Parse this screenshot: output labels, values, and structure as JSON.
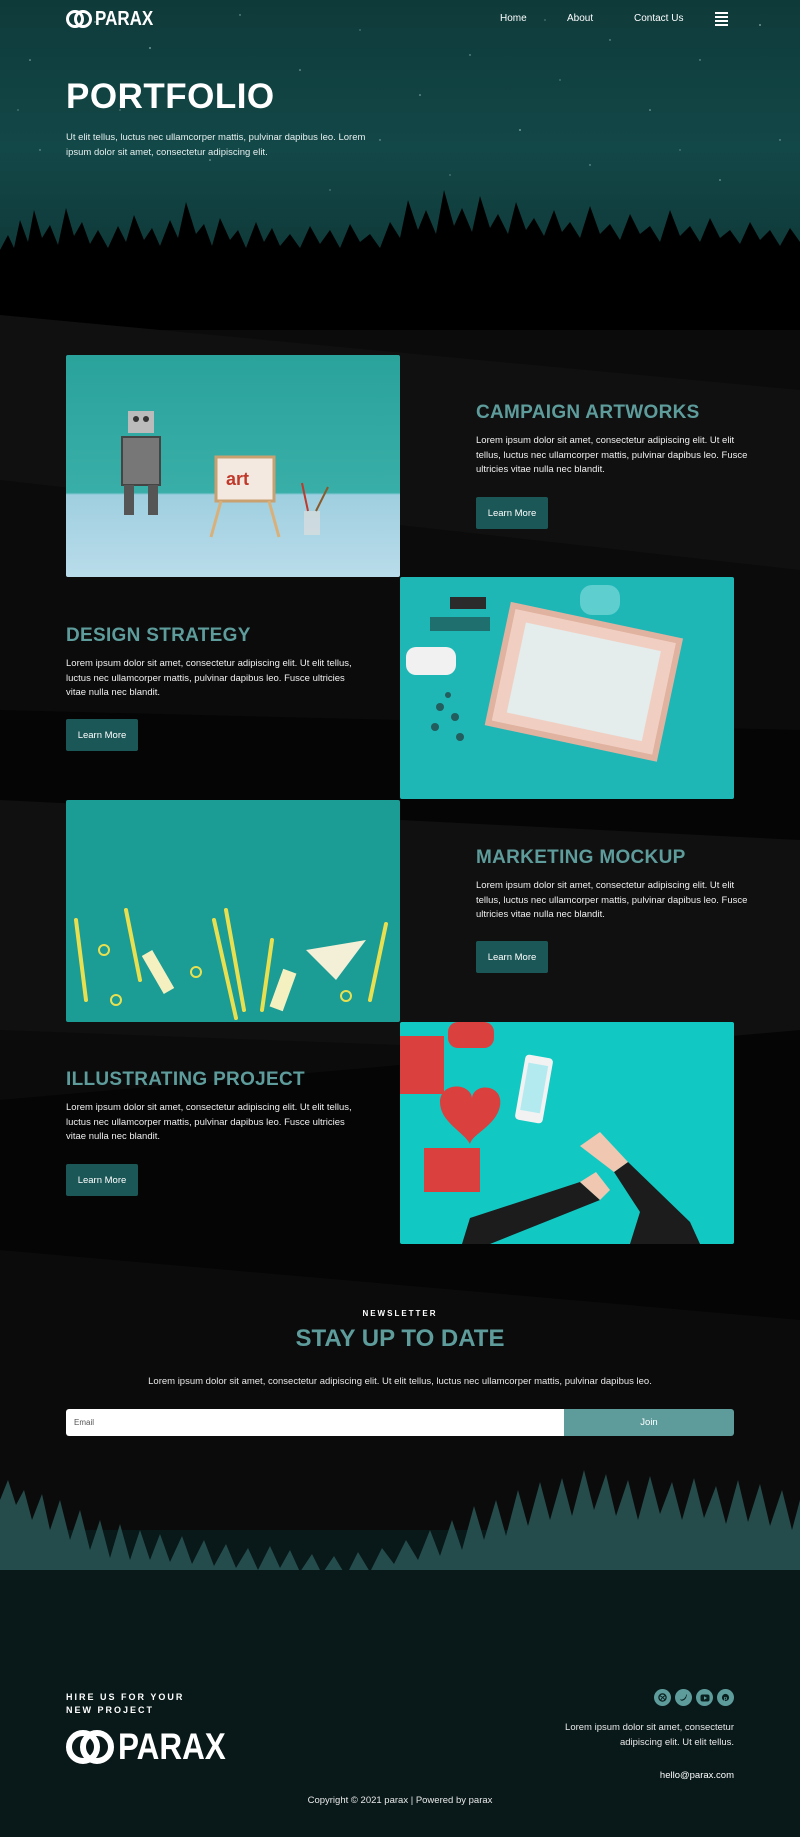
{
  "brand": {
    "name": "PARAX"
  },
  "nav": {
    "links": [
      "Home",
      "About",
      "Contact Us"
    ],
    "menu_icon": "hamburger-icon"
  },
  "hero": {
    "title": "PORTFOLIO",
    "subtitle": "Ut elit tellus, luctus nec ullamcorper mattis, pulvinar dapibus leo. Lorem ipsum dolor sit amet, consectetur adipiscing elit."
  },
  "portfolio": [
    {
      "title": "CAMPAIGN ARTWORKS",
      "text": "Lorem ipsum dolor sit amet, consectetur adipiscing elit. Ut elit tellus, luctus nec ullamcorper mattis, pulvinar dapibus leo. Fusce ultricies vitae nulla nec blandit.",
      "button": "Learn More"
    },
    {
      "title": "DESIGN STRATEGY",
      "text": "Lorem ipsum dolor sit amet, consectetur adipiscing elit. Ut elit tellus, luctus nec ullamcorper mattis, pulvinar dapibus leo. Fusce ultricies vitae nulla nec blandit.",
      "button": "Learn More"
    },
    {
      "title": "MARKETING MOCKUP",
      "text": "Lorem ipsum dolor sit amet, consectetur adipiscing elit. Ut elit tellus, luctus nec ullamcorper mattis, pulvinar dapibus leo. Fusce ultricies vitae nulla nec blandit.",
      "button": "Learn More"
    },
    {
      "title": "ILLUSTRATING PROJECT",
      "text": "Lorem ipsum dolor sit amet, consectetur adipiscing elit. Ut elit tellus, luctus nec ullamcorper mattis, pulvinar dapibus leo. Fusce ultricies vitae nulla nec blandit.",
      "button": "Learn More"
    }
  ],
  "newsletter": {
    "kicker": "NEWSLETTER",
    "title": "STAY UP TO DATE",
    "description": "Lorem ipsum dolor sit amet, consectetur adipiscing elit. Ut elit tellus, luctus nec ullamcorper mattis, pulvinar dapibus leo.",
    "email_placeholder": "Email",
    "button": "Join"
  },
  "footer": {
    "hire_line1": "HIRE US FOR YOUR",
    "hire_line2": "NEW PROJECT",
    "description": "Lorem ipsum dolor sit amet, consectetur adipiscing elit. Ut elit tellus.",
    "email": "hello@parax.com",
    "copyright": "Copyright © 2021 parax | Powered by parax",
    "socials": [
      "dribbble-icon",
      "twitter-icon",
      "youtube-icon",
      "pinterest-icon"
    ]
  },
  "colors": {
    "accent": "#5e9c9c",
    "button": "#1c5757",
    "hero_bg": "#134848",
    "page_bg": "#0b0b0b"
  }
}
